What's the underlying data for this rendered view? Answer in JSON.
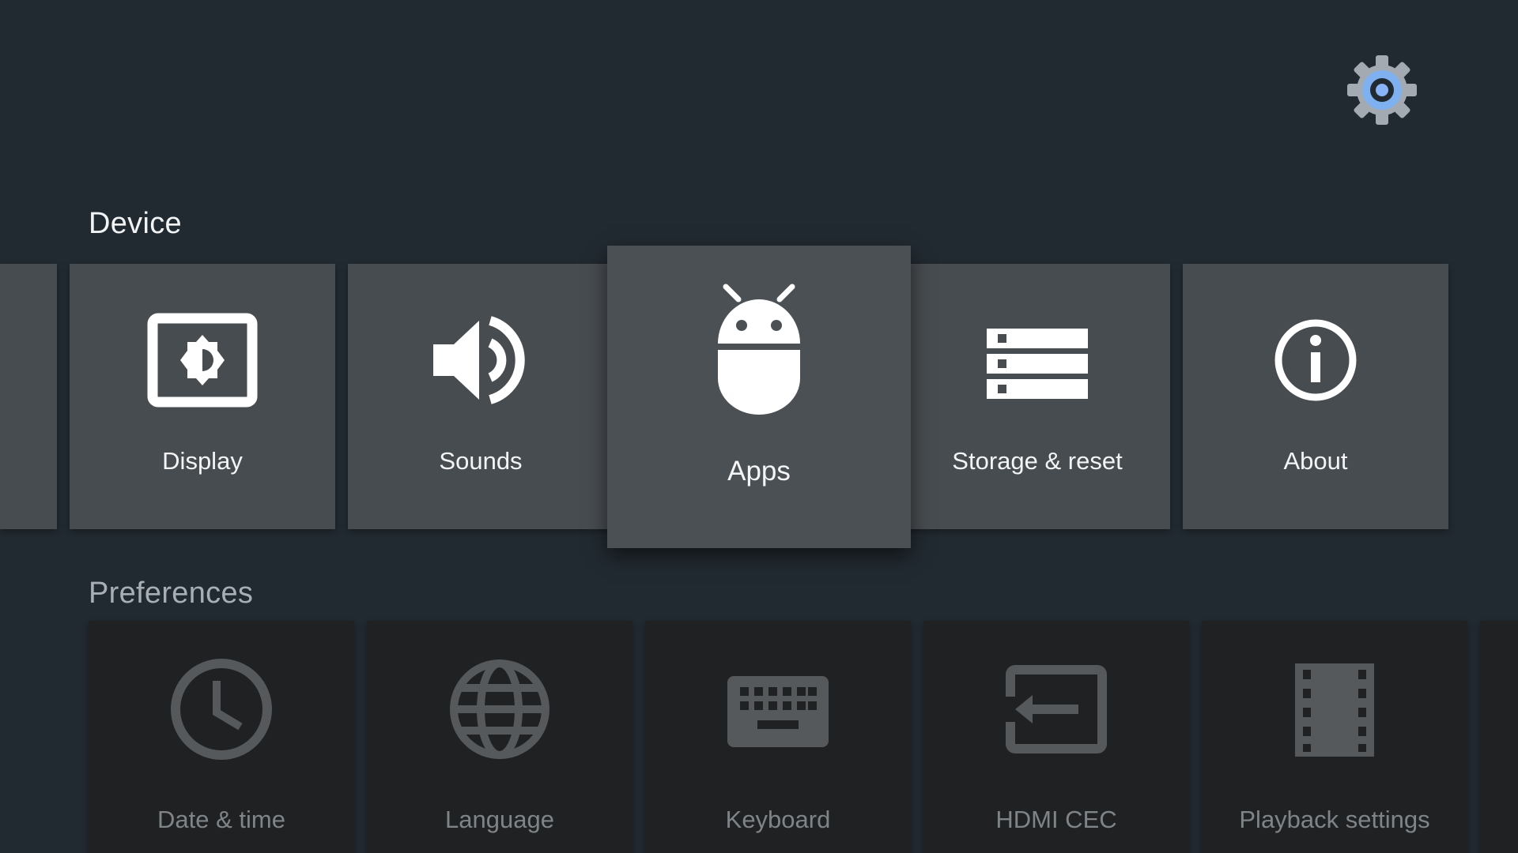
{
  "header": {
    "settings_icon": "gear-icon",
    "accent": "#8ab4f8"
  },
  "device": {
    "title": "Device",
    "items": [
      {
        "label": "Display",
        "icon": "display-brightness-icon"
      },
      {
        "label": "Sounds",
        "icon": "speaker-volume-icon"
      },
      {
        "label": "Apps",
        "icon": "android-icon",
        "focused": true
      },
      {
        "label": "Storage & reset",
        "icon": "storage-icon"
      },
      {
        "label": "About",
        "icon": "info-icon"
      }
    ]
  },
  "preferences": {
    "title": "Preferences",
    "items": [
      {
        "label": "Date & time",
        "icon": "clock-icon"
      },
      {
        "label": "Language",
        "icon": "globe-icon"
      },
      {
        "label": "Keyboard",
        "icon": "keyboard-icon"
      },
      {
        "label": "HDMI CEC",
        "icon": "hdmi-input-icon"
      },
      {
        "label": "Playback settings",
        "icon": "film-icon"
      }
    ]
  },
  "colors": {
    "background": "#222a31",
    "card": "#474c50",
    "card_dim": "#1f2123",
    "icon": "#ffffff",
    "icon_dim": "#55595c"
  }
}
